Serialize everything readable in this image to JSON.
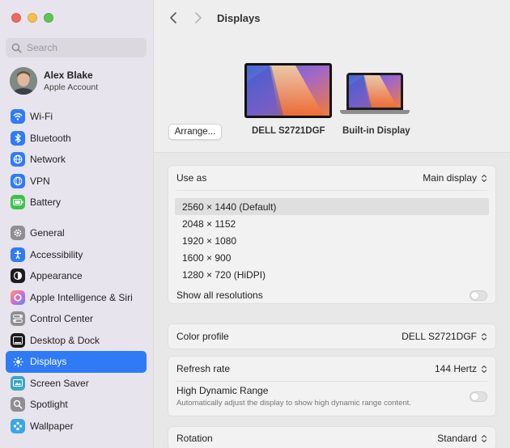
{
  "window": {
    "title": "Displays"
  },
  "search": {
    "placeholder": "Search"
  },
  "account": {
    "name": "Alex Blake",
    "subtitle": "Apple Account"
  },
  "sidebar": {
    "group1": [
      {
        "label": "Wi-Fi",
        "icon": "wifi-icon",
        "color": "#2f7bf6"
      },
      {
        "label": "Bluetooth",
        "icon": "bluetooth-icon",
        "color": "#2f7bf6"
      },
      {
        "label": "Network",
        "icon": "network-icon",
        "color": "#2f7bf6"
      },
      {
        "label": "VPN",
        "icon": "vpn-icon",
        "color": "#2f7bf6"
      },
      {
        "label": "Battery",
        "icon": "battery-icon",
        "color": "#3cc24a"
      }
    ],
    "group2": [
      {
        "label": "General",
        "icon": "gear-icon",
        "color": "#8e8e93"
      },
      {
        "label": "Accessibility",
        "icon": "accessibility-icon",
        "color": "#2f7bf6"
      },
      {
        "label": "Appearance",
        "icon": "appearance-icon",
        "color": "#1c1c1e"
      },
      {
        "label": "Apple Intelligence & Siri",
        "icon": "siri-icon",
        "color": "#d46bd4"
      },
      {
        "label": "Control Center",
        "icon": "control-center-icon",
        "color": "#8e8e93"
      },
      {
        "label": "Desktop & Dock",
        "icon": "dock-icon",
        "color": "#1c1c1e"
      },
      {
        "label": "Displays",
        "icon": "displays-icon",
        "color": "#2f7bf6",
        "active": true
      },
      {
        "label": "Screen Saver",
        "icon": "screen-saver-icon",
        "color": "#3aa6c8"
      },
      {
        "label": "Spotlight",
        "icon": "spotlight-icon",
        "color": "#8e8e93"
      },
      {
        "label": "Wallpaper",
        "icon": "wallpaper-icon",
        "color": "#3aa6e8"
      }
    ]
  },
  "toolbar": {
    "title": "Displays"
  },
  "displays": {
    "arrange_label": "Arrange...",
    "external_name": "DELL S2721DGF",
    "builtin_name": "Built-in Display"
  },
  "settings": {
    "use_as": {
      "label": "Use as",
      "value": "Main display"
    },
    "resolutions": [
      {
        "label": "2560 × 1440 (Default)",
        "selected": true
      },
      {
        "label": "2048 × 1152"
      },
      {
        "label": "1920 × 1080"
      },
      {
        "label": "1600 × 900"
      },
      {
        "label": "1280 × 720 (HiDPI)"
      }
    ],
    "show_all": {
      "label": "Show all resolutions",
      "on": false
    },
    "color_profile": {
      "label": "Color profile",
      "value": "DELL S2721DGF"
    },
    "refresh_rate": {
      "label": "Refresh rate",
      "value": "144 Hertz"
    },
    "hdr": {
      "label": "High Dynamic Range",
      "description": "Automatically adjust the display to show high dynamic range content.",
      "on": false
    },
    "rotation": {
      "label": "Rotation",
      "value": "Standard"
    }
  }
}
